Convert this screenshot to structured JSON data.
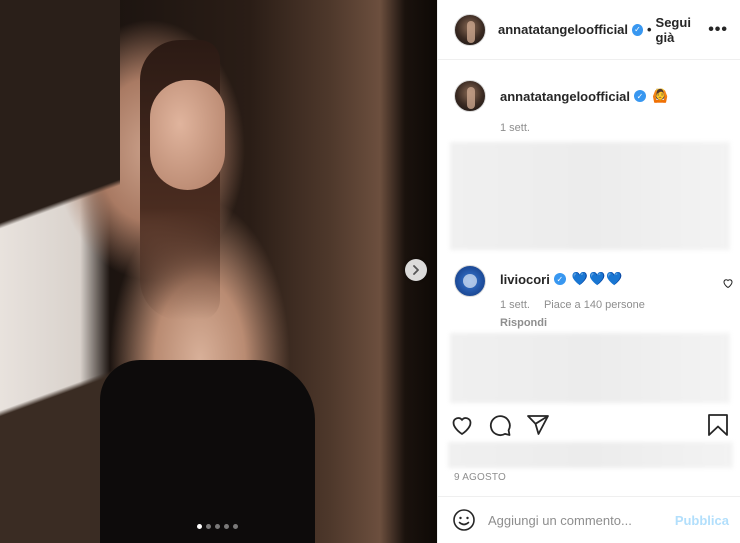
{
  "post": {
    "username": "annatatangeloofficial",
    "follow_separator": "•",
    "follow_label": "Segui già",
    "more_label": "•••",
    "caption_emoji": "🙆",
    "caption_time": "1 sett.",
    "carousel": {
      "count": 5,
      "active_index": 0
    }
  },
  "comments": [
    {
      "username": "liviocori",
      "text": "💙💙💙",
      "time": "1 sett.",
      "likes": "Piace a 140 persone",
      "reply_label": "Rispondi"
    }
  ],
  "footer": {
    "date": "9 AGOSTO",
    "comment_placeholder": "Aggiungi un commento...",
    "publish_label": "Pubblica"
  },
  "icons": {
    "like": "heart-icon",
    "comment": "comment-icon",
    "share": "share-icon",
    "save": "bookmark-icon",
    "emoji": "emoji-icon",
    "next": "chevron-right-icon",
    "verified": "verified-badge-icon"
  },
  "colors": {
    "accent": "#0095f6",
    "verified": "#3897f0",
    "publish_disabled": "#b2dffc"
  }
}
